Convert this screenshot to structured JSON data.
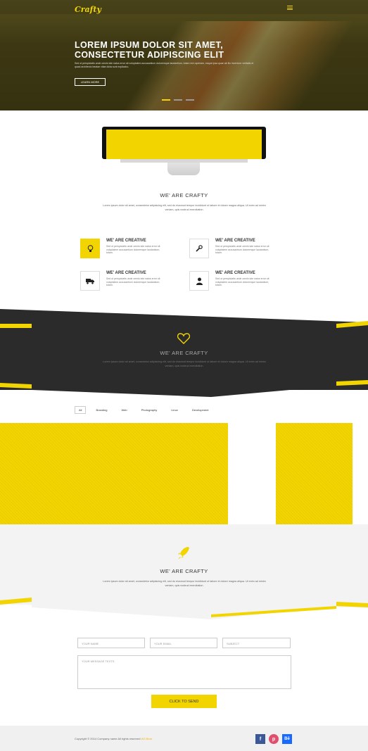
{
  "header": {
    "logo": "Crafty"
  },
  "hero": {
    "title": "LOREM IPSUM DOLOR SIT AMET, CONSECTETUR ADIPISCING ELIT",
    "text": "Sed ut perspiciatis unde omnis iste natus error sit voluptatem accusantium doloremque laudantium, totam rem aperiam, eaque ipsa quae ab illo inventore veritatis et quasi architecto beatae vitae dicta sunt explicabo.",
    "button": "LEARN MORE"
  },
  "about": {
    "title": "WE' ARE CRAFTY",
    "text": "Lorem ipsum dolor sit amet, consectetur adipisicing elit, sed do eiusmod tempor incididunt ut labore et dolore magna aliqua. Ut enim ad minim veniam, quis nostrud exercitation."
  },
  "features": [
    {
      "title": "WE' ARE CREATIVE",
      "text": "Sed ut perspiciatis unde omnis iste natus error sit voluptatem accusantium doloremque laudantium, totam.",
      "icon": "lightbulb-icon"
    },
    {
      "title": "WE' ARE CREATIVE",
      "text": "Sed ut perspiciatis unde omnis iste natus error sit voluptatem accusantium doloremque laudantium, totam.",
      "icon": "wrench-icon"
    },
    {
      "title": "WE' ARE CREATIVE",
      "text": "Sed ut perspiciatis unde omnis iste natus error sit voluptatem accusantium doloremque laudantium, totam.",
      "icon": "truck-icon"
    },
    {
      "title": "WE' ARE CREATIVE",
      "text": "Sed ut perspiciatis unde omnis iste natus error sit voluptatem accusantium doloremque laudantium, totam.",
      "icon": "user-icon"
    }
  ],
  "band": {
    "title": "WE' ARE CRAFTY",
    "text": "Lorem ipsum dolor sit amet, consectetur adipisicing elit, sed do eiusmod tempor incididunt ut labore et dolore magna aliqua. Ut enim ad minim veniam, quis nostrud exercitation."
  },
  "portfolio": {
    "filters": [
      "All",
      "Branding",
      "Web",
      "Photography",
      "Linux",
      "Development"
    ]
  },
  "crafty2": {
    "title": "WE' ARE CRAFTY",
    "text": "Lorem ipsum dolor sit amet, consectetur adipisicing elit, sed do eiusmod tempor incididunt ut labore et dolore magna aliqua. Ut enim ad minim veniam, quis nostrud exercitation."
  },
  "contact": {
    "name_placeholder": "YOUR NAME",
    "email_placeholder": "YOUR EMAIL",
    "subject_placeholder": "SUBJECT",
    "message_placeholder": "YOUR MESSAGE TEXTS",
    "send": "CLICK TO SEND"
  },
  "footer": {
    "copyright": "Copyright © 2014 Company name All rights reserved",
    "brand": "W3 Bear",
    "social": [
      "f",
      "p",
      "Bē"
    ]
  },
  "colors": {
    "accent": "#f2d500",
    "dark": "#2b2b2b"
  }
}
